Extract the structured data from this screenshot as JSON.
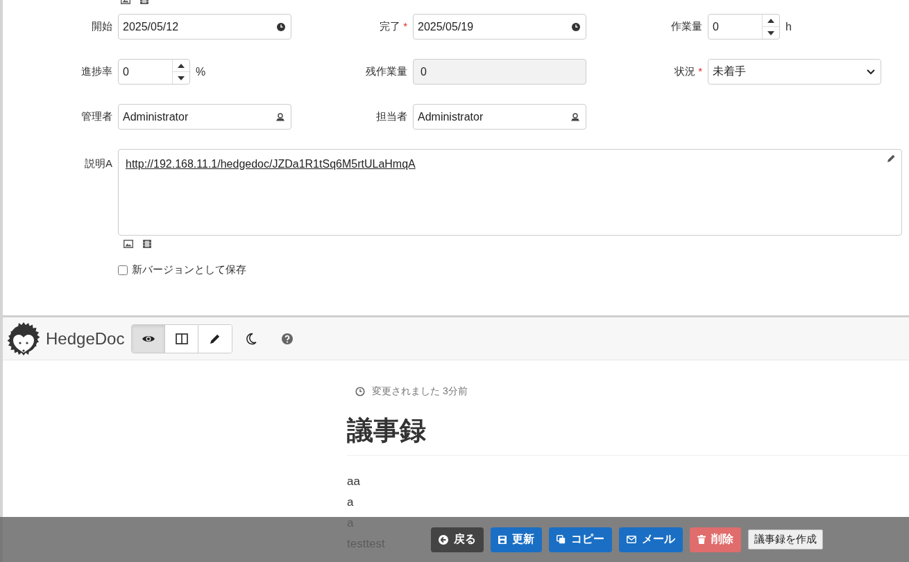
{
  "form": {
    "rows": [
      [
        {
          "label": "開始",
          "kind": "date",
          "value": "2025/05/12"
        },
        {
          "label": "完了",
          "required_mark": "*",
          "kind": "date",
          "value": "2025/05/19"
        },
        {
          "label": "作業量",
          "kind": "number",
          "value": "0",
          "unit": "h"
        }
      ],
      [
        {
          "label": "進捗率",
          "kind": "number",
          "value": "0",
          "unit": "%"
        },
        {
          "label": "残作業量",
          "kind": "readonly",
          "value": "0"
        },
        {
          "label": "状況",
          "required_mark": "*",
          "kind": "select",
          "value": "未着手"
        }
      ],
      [
        {
          "label": "管理者",
          "kind": "user",
          "value": "Administrator"
        },
        {
          "label": "担当者",
          "kind": "user",
          "value": "Administrator"
        }
      ]
    ],
    "description": {
      "label": "説明A",
      "link": "http://192.168.11.1/hedgedoc/JZDa1R1tSq6M5rtULaHmqA"
    },
    "save_as_new_version": {
      "label": "新バージョンとして保存",
      "checked": false
    }
  },
  "hedgedoc": {
    "brand": "HedgeDoc",
    "modes": [
      {
        "kind": "view",
        "selected": true
      },
      {
        "kind": "both",
        "selected": false
      },
      {
        "kind": "edit",
        "selected": false
      }
    ],
    "meta": "変更されました 3分前",
    "title": "議事録",
    "paragraphs": [
      "aa",
      "a",
      "a",
      "testtest"
    ]
  },
  "action_bar": [
    {
      "label": "戻る",
      "kind": "back"
    },
    {
      "label": "更新",
      "kind": "save"
    },
    {
      "label": "コピー",
      "kind": "copy"
    },
    {
      "label": "メール",
      "kind": "mail"
    },
    {
      "label": "削除",
      "kind": "delete"
    },
    {
      "label": "議事録を作成",
      "kind": "plain"
    }
  ]
}
